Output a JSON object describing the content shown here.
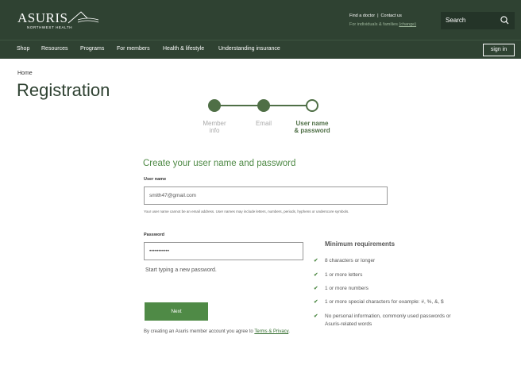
{
  "header": {
    "logo_word": "ASURIS",
    "logo_sub": "NORTHWEST HEALTH",
    "find_doctor": "Find a doctor",
    "contact_us": "Contact us",
    "audience_text": "For individuals & families",
    "change_link": "(change)",
    "search_label": "Search"
  },
  "nav": {
    "items": [
      "Shop",
      "Resources",
      "Programs",
      "For members",
      "Health & lifestyle",
      "Understanding insurance"
    ],
    "sign_in": "sign in"
  },
  "breadcrumb": "Home",
  "page_title": "Registration",
  "stepper": {
    "steps": [
      {
        "label": "Member\ninfo",
        "state": "complete"
      },
      {
        "label": "Email",
        "state": "complete"
      },
      {
        "label": "User name\n& password",
        "state": "current"
      }
    ]
  },
  "form": {
    "title": "Create your user name and password",
    "username_label": "User name",
    "username_value": "smith47@gmail.com",
    "username_hint": "Your user name cannot be an email address. User names may include letters, numbers, periods, hyphens or underscore symbols.",
    "password_label": "Password",
    "password_value": "•••••••••••",
    "password_hint": "Start typing a new password.",
    "next_label": "Next",
    "terms_prefix": "By creating an Asuris member account you agree to ",
    "terms_link": "Terms & Privacy",
    "terms_suffix": "."
  },
  "requirements": {
    "title": "Minimum requirements",
    "items": [
      "8 characters or longer",
      "1 or more letters",
      "1 or more numbers",
      "1 or more special characters for example: #, %, &, $",
      "No personal information, commonly used passwords or Asuris-related words"
    ]
  },
  "colors": {
    "header_bg": "#2f4232",
    "accent_green": "#4f8a46",
    "stepper_green": "#4f6f46"
  }
}
